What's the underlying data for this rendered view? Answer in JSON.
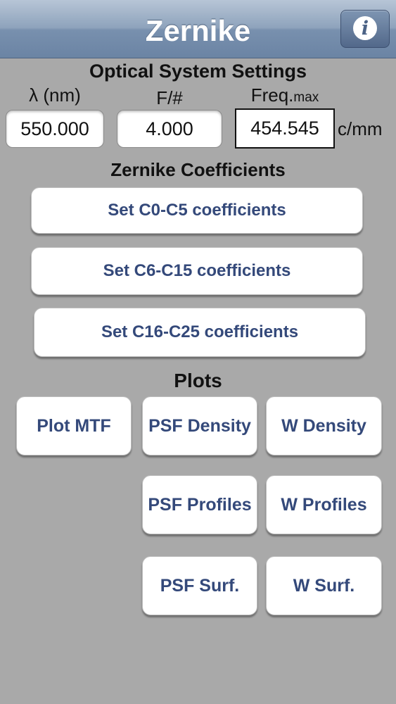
{
  "header": {
    "title": "Zernike",
    "info_icon": "info-icon"
  },
  "optical": {
    "title": "Optical System Settings",
    "wavelength": {
      "label": "λ (nm)",
      "value": "550.000"
    },
    "fnumber": {
      "label": "F/#",
      "value": "4.000"
    },
    "freqmax": {
      "label_main": "Freq.",
      "label_sub": "max",
      "value": "454.545",
      "unit": "c/mm"
    }
  },
  "zernike": {
    "title": "Zernike Coefficients",
    "buttons": [
      "Set C0-C5 coefficients",
      "Set C6-C15 coefficients",
      "Set C16-C25 coefficients"
    ]
  },
  "plots": {
    "title": "Plots",
    "plot_mtf": "Plot MTF",
    "psf_density": "PSF Density",
    "w_density": "W Density",
    "psf_profiles": "PSF Profiles",
    "w_profiles": "W Profiles",
    "psf_surf": "PSF Surf.",
    "w_surf": "W Surf."
  }
}
